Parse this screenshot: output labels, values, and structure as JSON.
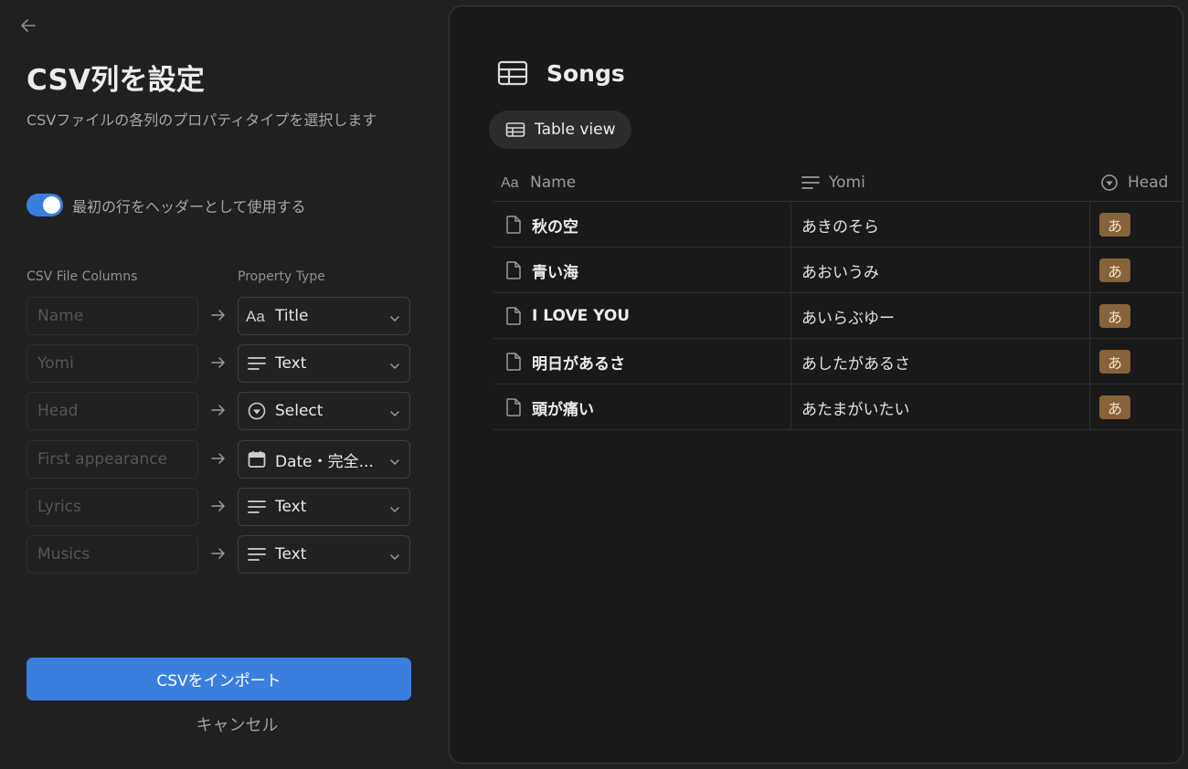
{
  "page": {
    "title": "CSV列を設定",
    "subtitle": "CSVファイルの各列のプロパティタイプを選択します",
    "header_toggle": {
      "label": "最初の行をヘッダーとして使用する",
      "on": true
    },
    "columns_header": {
      "csv": "CSV File Columns",
      "property": "Property Type"
    },
    "mappings": [
      {
        "placeholder": "Name",
        "type": "Title",
        "icon": "title-aa-icon"
      },
      {
        "placeholder": "Yomi",
        "type": "Text",
        "icon": "text-lines-icon"
      },
      {
        "placeholder": "Head",
        "type": "Select",
        "icon": "select-circle-icon"
      },
      {
        "placeholder": "First appearance",
        "type": "Date・完全...",
        "icon": "calendar-icon"
      },
      {
        "placeholder": "Lyrics",
        "type": "Text",
        "icon": "text-lines-icon"
      },
      {
        "placeholder": "Musics",
        "type": "Text",
        "icon": "text-lines-icon"
      }
    ],
    "import_button": "CSVをインポート",
    "cancel_button": "キャンセル",
    "accent_color": "#3b7fde"
  },
  "preview": {
    "db_title": "Songs",
    "view_tab": "Table view",
    "columns": [
      {
        "label": "Name",
        "icon": "aa-icon"
      },
      {
        "label": "Yomi",
        "icon": "text-lines-icon"
      },
      {
        "label": "Head",
        "icon": "select-circle-icon"
      }
    ],
    "rows": [
      {
        "name": "秋の空",
        "yomi": "あきのそら",
        "head": "あ"
      },
      {
        "name": "青い海",
        "yomi": "あおいうみ",
        "head": "あ"
      },
      {
        "name": "I LOVE YOU",
        "yomi": "あいらぶゆー",
        "head": "あ"
      },
      {
        "name": "明日があるさ",
        "yomi": "あしたがあるさ",
        "head": "あ"
      },
      {
        "name": "頭が痛い",
        "yomi": "あたまがいたい",
        "head": "あ"
      }
    ],
    "badge_color": "#86633a"
  }
}
